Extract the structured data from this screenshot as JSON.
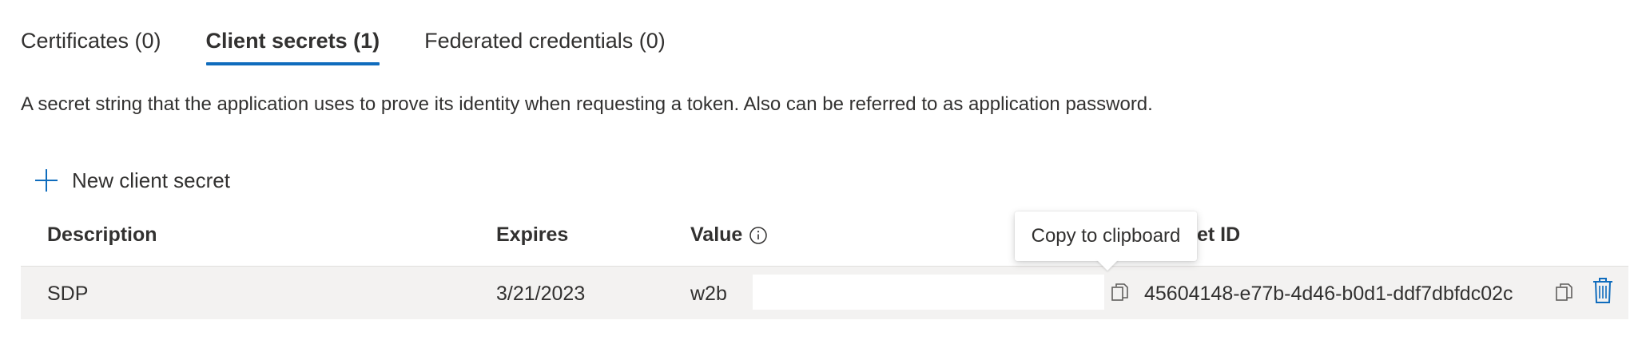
{
  "tabs": [
    {
      "label": "Certificates (0)",
      "active": false
    },
    {
      "label": "Client secrets (1)",
      "active": true
    },
    {
      "label": "Federated credentials (0)",
      "active": false
    }
  ],
  "description": "A secret string that the application uses to prove its identity when requesting a token. Also can be referred to as application password.",
  "toolbar": {
    "new_secret_label": "New client secret",
    "new_secret_icon": "plus-icon"
  },
  "table": {
    "columns": {
      "description": "Description",
      "expires": "Expires",
      "value": "Value",
      "secret_id": "et ID"
    },
    "rows": [
      {
        "description": "SDP",
        "expires": "3/21/2023",
        "value": "w2b",
        "secret_id": "45604148-e77b-4d46-b0d1-ddf7dbfdc02c"
      }
    ]
  },
  "tooltip": {
    "text": "Copy to clipboard"
  },
  "icons": {
    "info": "info-icon",
    "copy": "copy-icon",
    "delete": "trash-icon"
  },
  "colors": {
    "accent": "#0f6cbd",
    "row_background": "#f3f2f1",
    "text": "#323130"
  }
}
